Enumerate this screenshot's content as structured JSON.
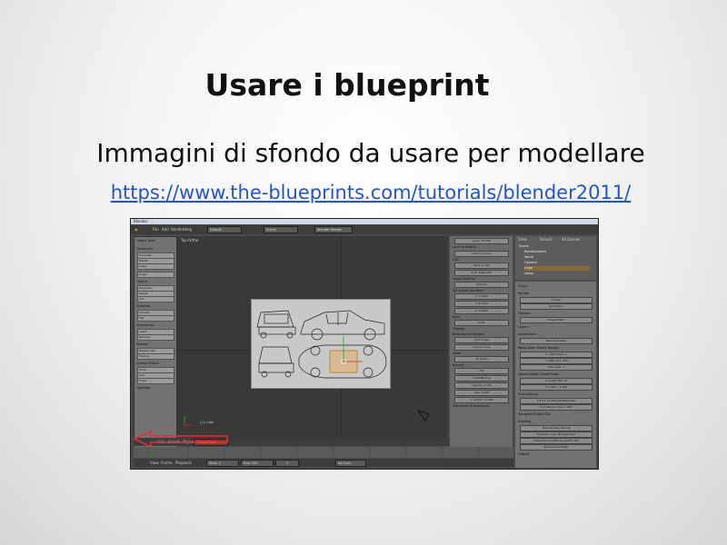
{
  "slide": {
    "title": "Usare i blueprint",
    "subtitle": "Immagini di sfondo da usare per modellare",
    "link": "https://www.the-blueprints.com/tutorials/blender2011/"
  },
  "blender": {
    "window_title": "Blender",
    "menu": [
      "File",
      "Add",
      "Render",
      "Help"
    ],
    "layout": "Default",
    "scene": "Scene",
    "engine": "Blender Render",
    "viewport_label": "Top Ortho",
    "object_label": "(1) Cube",
    "mode": "Object Mode",
    "header_items": [
      "View",
      "Select",
      "Object"
    ],
    "timeline_items": [
      "View",
      "Frame",
      "Playback"
    ],
    "start_frame": "Start: 1",
    "end_frame": "End: 250",
    "current_frame": "1",
    "sync": "No Sync",
    "tool_sections": [
      {
        "head": "Object Tools",
        "items": []
      },
      {
        "head": "Transform:",
        "items": [
          "Translate",
          "Rotate",
          "Scale"
        ]
      },
      {
        "head": "",
        "items": [
          "Origin"
        ]
      },
      {
        "head": "Object:",
        "items": [
          "Duplicate",
          "Delete",
          "Join"
        ]
      },
      {
        "head": "Shading:",
        "items": [
          "Smooth",
          "Flat"
        ]
      },
      {
        "head": "Keyframes:",
        "items": [
          "Insert",
          "Remove"
        ]
      },
      {
        "head": "Repeat:",
        "items": [
          "Repeat Last",
          "History..."
        ]
      },
      {
        "head": "Grease Pencil:",
        "items": [
          "Draw",
          "Line",
          "Erase"
        ]
      },
      {
        "head": "Operator",
        "items": []
      }
    ],
    "n_panel": [
      {
        "label": "",
        "row": "Lens: 35.000"
      },
      {
        "label": "Lock to Object:",
        "row": ""
      },
      {
        "label": "",
        "row": "Lock to Cursor"
      },
      {
        "label": "Clip:",
        "row": "Start: 0.100"
      },
      {
        "label": "",
        "row": "End: 5000.000"
      },
      {
        "label": "Local Camera:",
        "row": "Camera"
      },
      {
        "label": "3D Cursor Location:",
        "row": "X: 0.0000"
      },
      {
        "label": "",
        "row": "Y: 0.7404"
      },
      {
        "label": "",
        "row": "Z: 0.0000"
      },
      {
        "label": "Item",
        "row": "Cube"
      },
      {
        "label": "Display",
        "row": ""
      },
      {
        "label": "Background Images",
        "row": "Add Image"
      },
      {
        "label": "",
        "row": "Camera Axis"
      },
      {
        "label": "View:",
        "row": "All Views"
      },
      {
        "label": "Source:",
        "row": "File"
      },
      {
        "label": "",
        "row": "car01BW.png"
      },
      {
        "label": "",
        "row": "Opacity: 0.500"
      },
      {
        "label": "",
        "row": "Size: 5.000"
      },
      {
        "label": "",
        "row": "X: 0.000   Y: 0.000"
      },
      {
        "label": "Transform Orientations",
        "row": ""
      }
    ],
    "outliner": {
      "header": [
        "View",
        "Search",
        "All Scenes"
      ],
      "items": [
        "Scene",
        "RenderLayers",
        "World",
        "Camera",
        "Cube",
        "Lamp"
      ]
    },
    "properties": [
      {
        "head": "Scene",
        "rows": []
      },
      {
        "head": "Render",
        "rows": [
          "Image",
          "Animation"
        ]
      },
      {
        "head": "Display:",
        "rows": [
          "Image Editor"
        ]
      },
      {
        "head": "Layers",
        "rows": []
      },
      {
        "head": "Dimensions",
        "rows": [
          "Render Presets"
        ]
      },
      {
        "head": "Resolution:   Frame Range:",
        "rows": [
          "X: 1920   Start: 1",
          "Y: 1080   End: 250",
          "50%   Step: 1"
        ]
      },
      {
        "head": "Aspect Ratio:   Frame Rate:",
        "rows": [
          "X: 1.000   FPS: 24",
          "Y: 1.000   /: 1.000"
        ]
      },
      {
        "head": "Anti-Aliasing",
        "rows": [
          "5  8  11  16   Mitchell-Netravali",
          "Full Sample   Size: 1.000"
        ]
      },
      {
        "head": "Sampled Motion Blur",
        "rows": []
      },
      {
        "head": "Shading",
        "rows": [
          "Textures   Ray Tracing",
          "Shadows   Color Management",
          "Subsurface Scattering   Alpha: Sky",
          "Environment Map"
        ]
      },
      {
        "head": "Output",
        "rows": []
      }
    ],
    "colors": {
      "arrow": "#e03030",
      "selection": "#f0a030",
      "panel": "#727272"
    }
  }
}
